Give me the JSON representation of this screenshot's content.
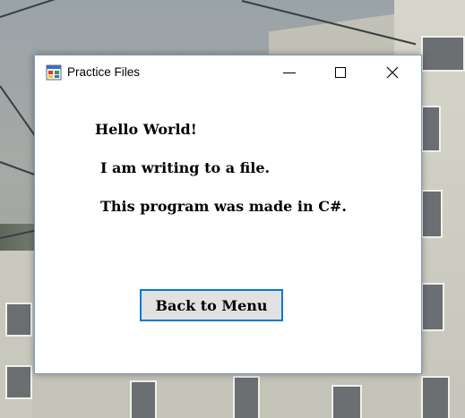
{
  "window": {
    "title": "Practice Files",
    "controls": {
      "minimize": "minimize-icon",
      "maximize": "maximize-icon",
      "close": "close-icon"
    }
  },
  "labels": {
    "line1": "Hello World!",
    "line2": "I am writing to a file.",
    "line3": "This program was made in C#."
  },
  "buttons": {
    "back_to_menu": "Back to Menu"
  },
  "colors": {
    "focus_border": "#0078d7",
    "button_face": "#e1e1e1"
  }
}
